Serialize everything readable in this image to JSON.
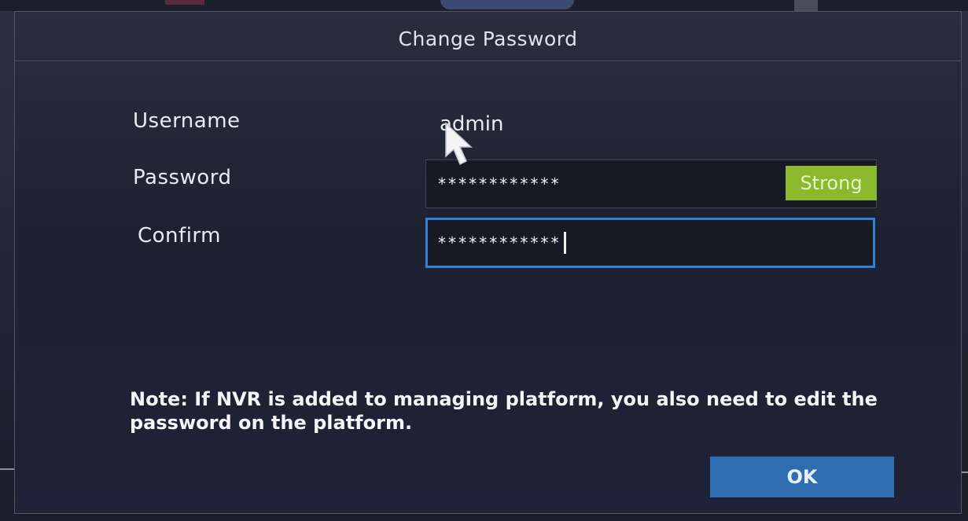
{
  "dialog": {
    "title": "Change Password"
  },
  "form": {
    "username_label": "Username",
    "username_value": "admin",
    "password_label": "Password",
    "password_value": "************",
    "password_strength": "Strong",
    "confirm_label": "Confirm",
    "confirm_value": "************"
  },
  "note": "Note: If NVR is added to managing platform, you also need to edit the password on the platform.",
  "buttons": {
    "ok_label": "OK"
  },
  "colors": {
    "accent": "#2f82d6",
    "strength_strong": "#8bb82d",
    "ok_button": "#2d6db0"
  },
  "icons": {
    "pointer": "mouse-pointer-icon"
  }
}
